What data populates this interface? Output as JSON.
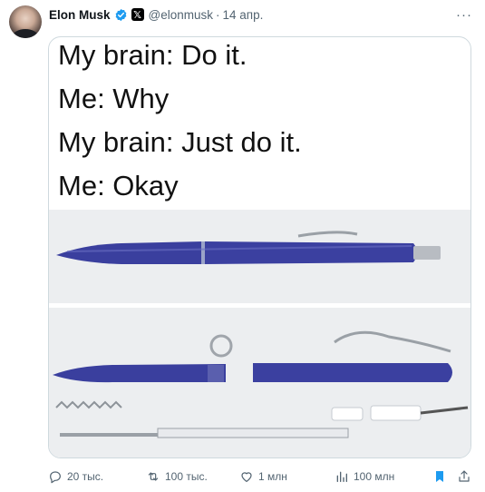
{
  "tweet": {
    "author_name": "Elon Musk",
    "handle": "@elonmusk",
    "separator": "·",
    "date": "14 апр.",
    "more": "···"
  },
  "meme": {
    "lines": [
      "My brain: Do it.",
      "Me: Why",
      "My brain: Just do it.",
      "Me: Okay"
    ]
  },
  "actions": {
    "replies": "20 тыс.",
    "reposts": "100 тыс.",
    "likes": "1 млн",
    "views": "100 млн"
  },
  "colors": {
    "verified": "#1d9bf0",
    "pen_blue": "#3a3f9e",
    "bookmark_active": "#1d9bf0",
    "muted_text": "#536471"
  }
}
